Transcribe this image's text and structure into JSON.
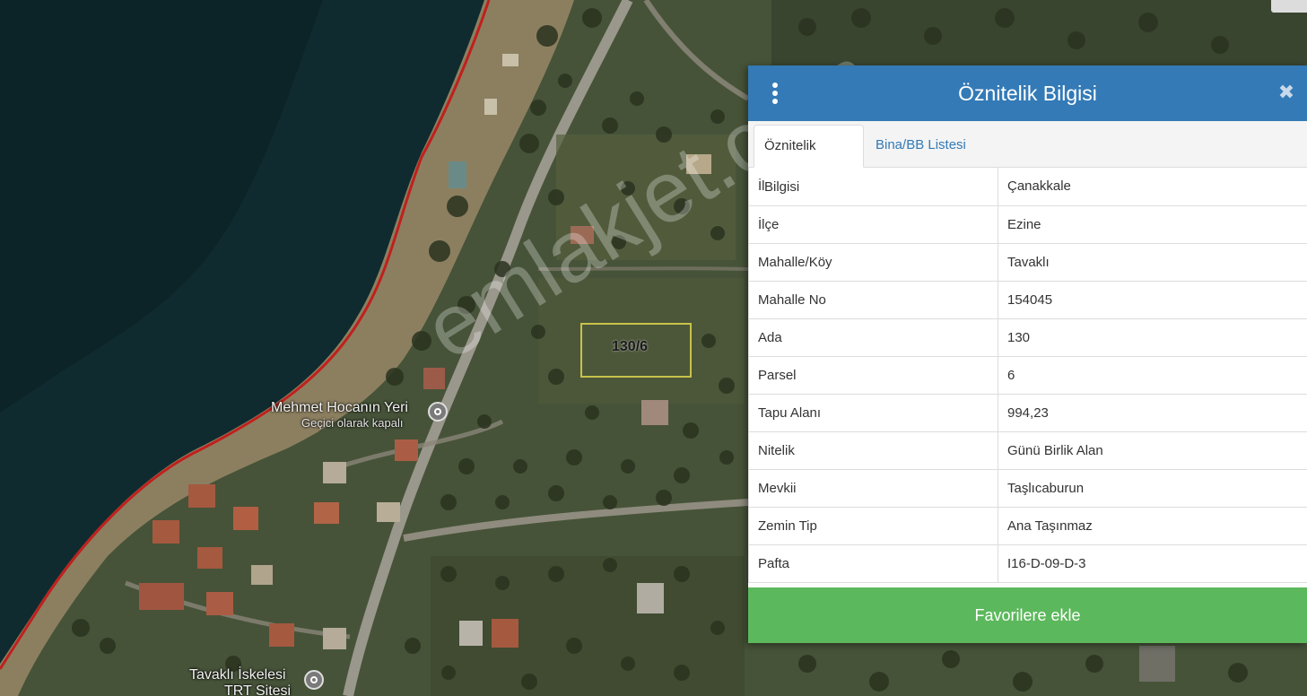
{
  "map": {
    "parcel_label": "130/6",
    "place_main": "Mehmet Hocanın Yeri",
    "place_sub": "Geçici olarak kapalı",
    "place2_main": "Tavaklı İskelesi",
    "place2_sub": "TRT Sitesi",
    "watermark": "emlakjet.com"
  },
  "panel": {
    "title": "Öznitelik Bilgisi",
    "menu_icon": "more-vertical-icon",
    "close_icon": "close-icon",
    "tabs": [
      {
        "label": "Öznitelik Bilgisi",
        "active": true
      },
      {
        "label": "Bina/BB Listesi",
        "active": false
      }
    ],
    "rows": [
      {
        "key": "İl",
        "value": "Çanakkale"
      },
      {
        "key": "İlçe",
        "value": "Ezine"
      },
      {
        "key": "Mahalle/Köy",
        "value": "Tavaklı"
      },
      {
        "key": "Mahalle No",
        "value": "154045"
      },
      {
        "key": "Ada",
        "value": "130"
      },
      {
        "key": "Parsel",
        "value": "6"
      },
      {
        "key": "Tapu Alanı",
        "value": "994,23"
      },
      {
        "key": "Nitelik",
        "value": "Günü Birlik Alan"
      },
      {
        "key": "Mevkii",
        "value": "Taşlıcaburun"
      },
      {
        "key": "Zemin Tip",
        "value": "Ana Taşınmaz"
      },
      {
        "key": "Pafta",
        "value": "I16-D-09-D-3"
      }
    ],
    "favorite_button": "Favorilere ekle"
  },
  "colors": {
    "header": "#337ab7",
    "button": "#5cb85c",
    "sea": "#0f2a2e",
    "boundary": "#c0201d"
  }
}
